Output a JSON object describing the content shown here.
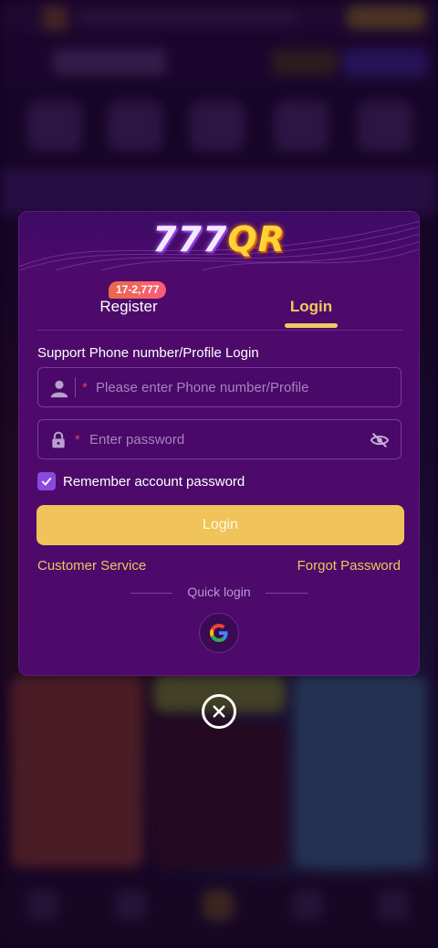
{
  "colors": {
    "modal_bg": "#4d0a6b",
    "accent_gold": "#f0c45a",
    "badge": "#ff5b7a",
    "checkbox": "#8a4ae0",
    "required_star": "#e0435a"
  },
  "modal": {
    "logo_num": "777",
    "logo_suffix": "QR",
    "tabs": [
      {
        "label": "Register",
        "badge": "17-2,777",
        "active": false
      },
      {
        "label": "Login",
        "active": true
      }
    ],
    "section_label": "Support Phone number/Profile Login",
    "phone_field": {
      "icon": "user-icon",
      "required_mark": "*",
      "placeholder": "Please enter Phone number/Profile",
      "value": ""
    },
    "password_field": {
      "icon": "lock-icon",
      "required_mark": "*",
      "placeholder": "Enter password",
      "value": "",
      "toggle_icon": "eye-off-icon"
    },
    "remember": {
      "label": "Remember account password",
      "checked": true
    },
    "login_button": "Login",
    "customer_service": "Customer Service",
    "forgot_password": "Forgot Password",
    "quick_login_label": "Quick login",
    "quick_login_provider_icon": "google-icon"
  },
  "close_icon": "close-circle-icon"
}
